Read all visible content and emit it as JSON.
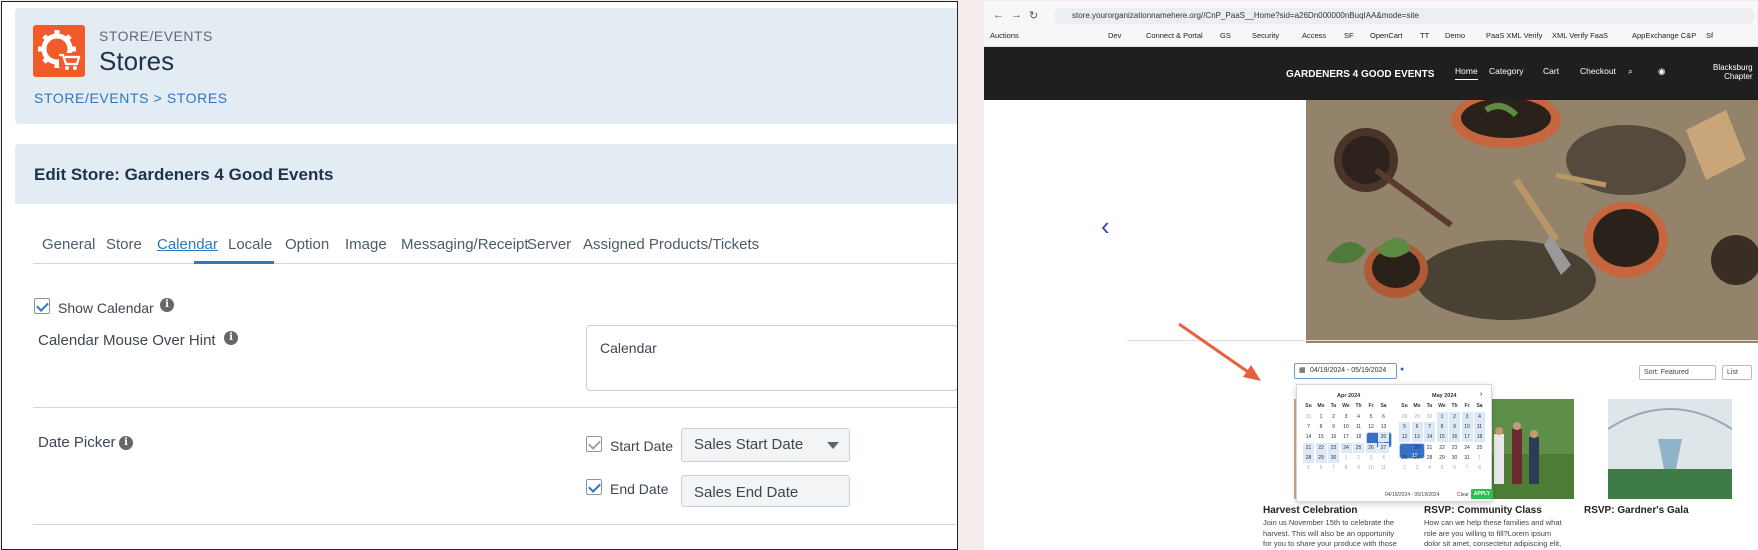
{
  "left_panel": {
    "breadcrumb_top": "STORE/EVENTS",
    "page_title": "Stores",
    "breadcrumb": "STORE/EVENTS > STORES",
    "edit_header": "Edit Store: Gardeners 4 Good Events",
    "tabs": [
      "General",
      "Store",
      "Calendar",
      "Locale",
      "Option",
      "Image",
      "Messaging/Receipt",
      "Server",
      "Assigned Products/Tickets"
    ],
    "active_tab": "Calendar",
    "show_calendar_label": "Show Calendar",
    "show_calendar_checked": true,
    "mouse_over_hint_label": "Calendar Mouse Over Hint",
    "mouse_over_hint_value": "Calendar",
    "date_picker_label": "Date Picker",
    "start_date_label": "Start Date",
    "start_date_checked": true,
    "start_date_select": "Sales Start Date",
    "end_date_label": "End Date",
    "end_date_checked": true,
    "end_date_value": "Sales End Date"
  },
  "browser": {
    "url": "store.yourorganizationnamehere.org//CnP_PaaS__Home?sid=a26Dn000000nBuqIAA&mode=site",
    "bookmarks": [
      "Auctions",
      "Dev",
      "Connect & Portal",
      "GS",
      "Security",
      "Access",
      "SF",
      "OpenCart",
      "TT",
      "Demo",
      "PaaS XML Verify",
      "XML Verify FaaS",
      "AppExchange C&P",
      "Sf"
    ]
  },
  "site": {
    "brand": "GARDENERS 4 GOOD EVENTS",
    "nav": [
      "Home",
      "Category",
      "Cart",
      "Checkout"
    ],
    "location_line1": "Blacksburg",
    "location_line2": "Chapter",
    "date_range": "04/19/2024 - 05/19/2024",
    "sort": "Sort: Featured",
    "list_label": "List",
    "picker": {
      "month_left": "Apr 2024",
      "month_right": "May 2024",
      "weekdays": [
        "Su",
        "Mo",
        "Tu",
        "We",
        "Th",
        "Fr",
        "Sa"
      ],
      "footer_range": "04/19/2024 - 05/19/2024",
      "clear": "Clear",
      "apply": "APPLY"
    },
    "cards": [
      {
        "title": "Harvest Celebration",
        "desc": "Join us November 15th to celebrate the harvest. This will also be an opportunity for you to share your produce with those in"
      },
      {
        "title": "RSVP: Community Class",
        "desc": "How can we help these families and what role are you willing to fill?Lorem ipsum dolor sit amet, consectetur adipiscing elit,"
      },
      {
        "title": "RSVP: Gardner's Gala",
        "desc": ""
      }
    ]
  },
  "colors": {
    "accent": "#2a79c4",
    "logo": "#f15b2a",
    "arrow": "#e8603c",
    "apply": "#2ebf4f"
  }
}
